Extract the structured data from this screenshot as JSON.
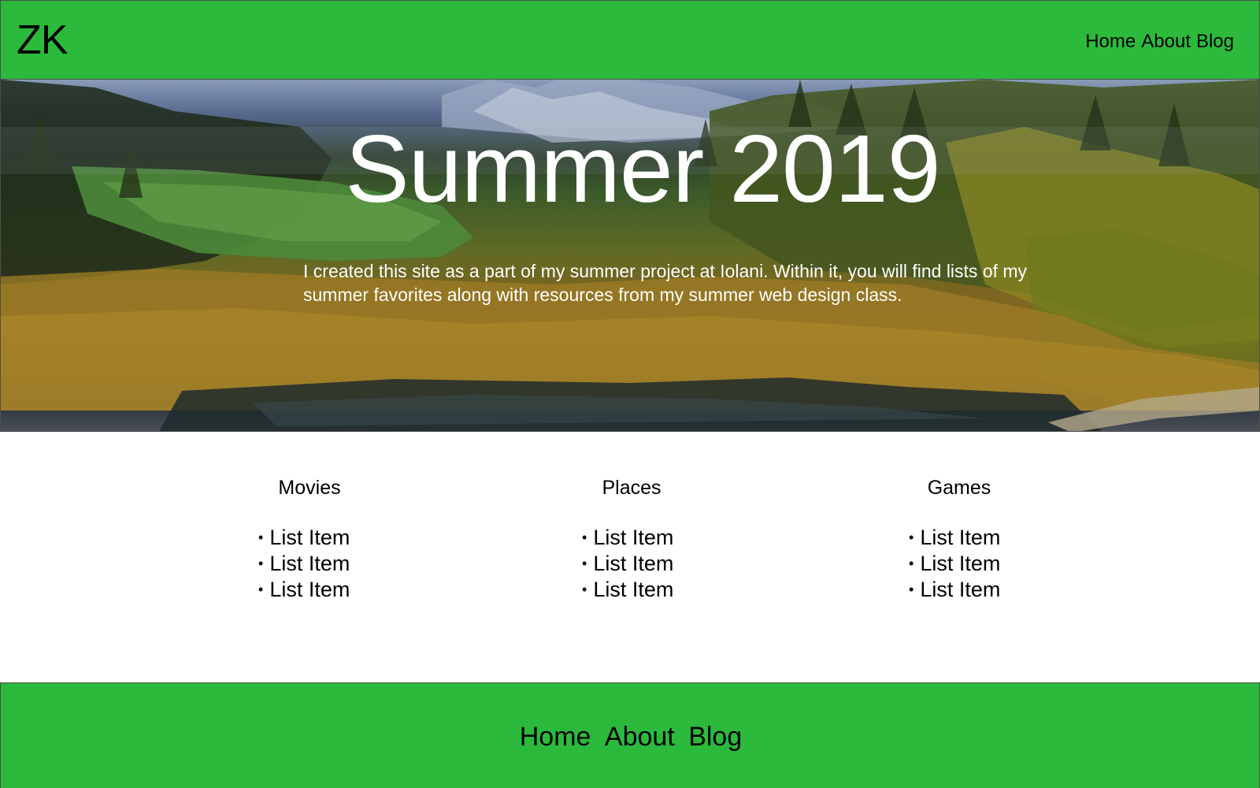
{
  "header": {
    "logo": "ZK",
    "nav": [
      "Home",
      "About",
      "Blog"
    ]
  },
  "hero": {
    "title": "Summer 2019",
    "description": "I created this site as a part of my summer project at Iolani. Within it, you will find lists of my summer favorites along with resources from my summer web design class."
  },
  "lists": [
    {
      "title": "Movies",
      "items": [
        "List Item",
        "List Item",
        "List Item"
      ]
    },
    {
      "title": "Places",
      "items": [
        "List Item",
        "List Item",
        "List Item"
      ]
    },
    {
      "title": "Games",
      "items": [
        "List Item",
        "List Item",
        "List Item"
      ]
    }
  ],
  "footer": {
    "nav": [
      "Home",
      "About",
      "Blog"
    ]
  },
  "colors": {
    "bar_green": "#2bba3c",
    "text": "#000000",
    "hero_text": "#ffffff"
  }
}
